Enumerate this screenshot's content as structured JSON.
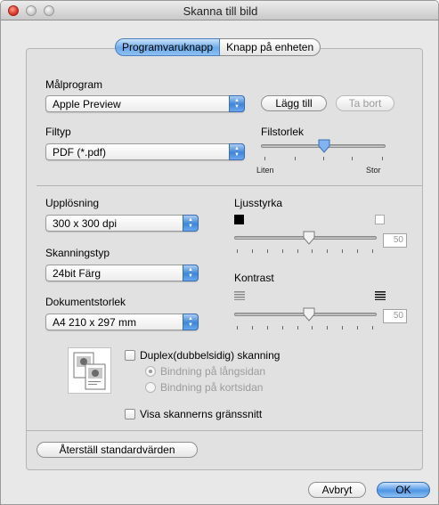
{
  "window": {
    "title": "Skanna till bild"
  },
  "tabs": [
    {
      "label": "Programvaruknapp",
      "active": true
    },
    {
      "label": "Knapp på enheten",
      "active": false
    }
  ],
  "target": {
    "label": "Målprogram",
    "value": "Apple Preview",
    "add_label": "Lägg till",
    "remove_label": "Ta bort"
  },
  "filetype": {
    "label": "Filtyp",
    "value": "PDF (*.pdf)"
  },
  "filesize": {
    "label": "Filstorlek",
    "min_label": "Liten",
    "max_label": "Stor",
    "level": 0.5
  },
  "resolution": {
    "label": "Upplösning",
    "value": "300 x 300 dpi"
  },
  "scantype": {
    "label": "Skanningstyp",
    "value": "24bit Färg"
  },
  "docsize": {
    "label": "Dokumentstorlek",
    "value": "A4  210 x 297 mm"
  },
  "brightness": {
    "label": "Ljusstyrka",
    "value": "50",
    "level": 0.5
  },
  "contrast": {
    "label": "Kontrast",
    "value": "50",
    "level": 0.5
  },
  "duplex": {
    "label": "Duplex(dubbelsidig) skanning",
    "checked": false,
    "long_edge_label": "Bindning på långsidan",
    "short_edge_label": "Bindning på kortsidan",
    "selected": "long_edge"
  },
  "show_interface": {
    "label": "Visa skannerns gränssnitt",
    "checked": false
  },
  "restore_label": "Återställ standardvärden",
  "cancel_label": "Avbryt",
  "ok_label": "OK",
  "colors": {
    "accent": "#4d95e4",
    "close": "#d9281a"
  }
}
